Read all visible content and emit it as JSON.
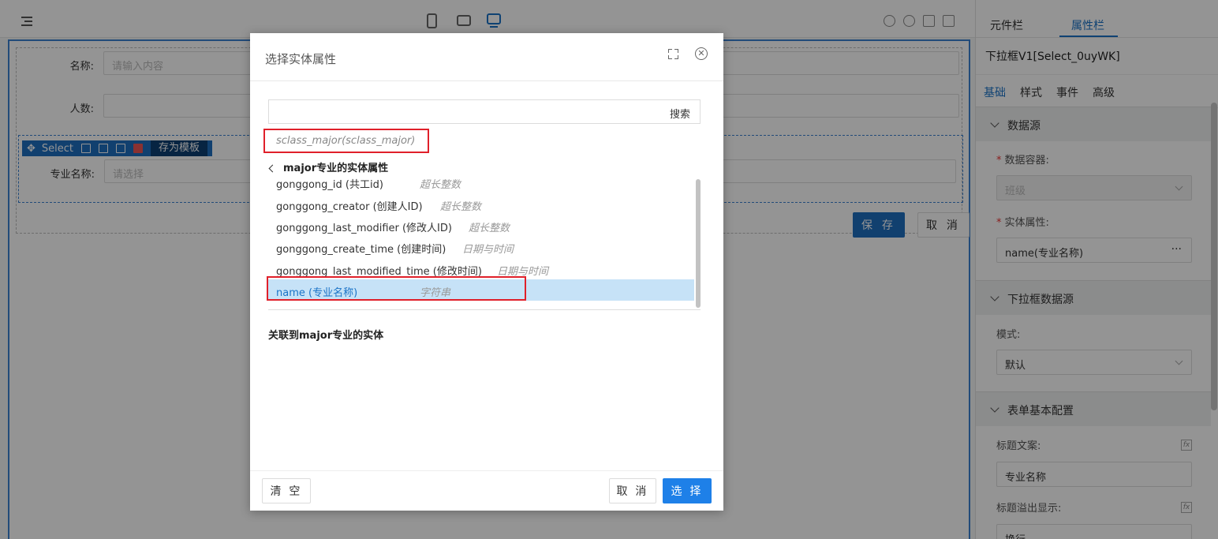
{
  "designer": {
    "form": {
      "name_label": "名称:",
      "name_placeholder": "请输入内容",
      "count_label": "人数:",
      "major_label": "专业名称:",
      "major_placeholder": "请选择"
    },
    "select_toolbar": {
      "label": "Select",
      "template_label": "存为模板"
    },
    "save_label": "保 存",
    "cancel_label": "取 消"
  },
  "right_panel": {
    "tabs": [
      "元件栏",
      "属性栏"
    ],
    "active_tab": "属性栏",
    "component_title": "下拉框V1[Select_0uyWK]",
    "subtabs": [
      "基础",
      "样式",
      "事件",
      "高级"
    ],
    "sections": {
      "datasource": {
        "title": "数据源",
        "container_label": "数据容器:",
        "container_value": "班级",
        "entity_attr_label": "实体属性:",
        "entity_attr_value": "name(专业名称)",
        "entity_attr_more": "···"
      },
      "select_datasource": {
        "title": "下拉框数据源",
        "mode_label": "模式:",
        "mode_value": "默认"
      },
      "form_config": {
        "title": "表单基本配置",
        "title_text_label": "标题文案:",
        "title_text_value": "专业名称",
        "overflow_label": "标题溢出显示:",
        "overflow_value": "换行",
        "fx_label": "fx"
      }
    }
  },
  "dialog": {
    "title": "选择实体属性",
    "search_button": "搜索",
    "breadcrumb": "sclass_major(sclass_major)",
    "back_label": "major专业的实体属性",
    "attributes": [
      {
        "name": "gonggong_id (共工id)",
        "type": "超长整数"
      },
      {
        "name": "gonggong_creator (创建人ID)",
        "type": "超长整数"
      },
      {
        "name": "gonggong_last_modifier (修改人ID)",
        "type": "超长整数"
      },
      {
        "name": "gonggong_create_time (创建时间)",
        "type": "日期与时间"
      },
      {
        "name": "gonggong_last_modified_time (修改时间)",
        "type": "日期与时间"
      },
      {
        "name": "name (专业名称)",
        "type": "字符串"
      }
    ],
    "selected_index": 5,
    "related_label": "关联到major专业的实体",
    "clear_label": "清 空",
    "cancel_label": "取 消",
    "choose_label": "选 择"
  },
  "colors": {
    "accent": "#1e80e8",
    "highlight": "#c6e2f7",
    "annotation_red": "#e0202a"
  }
}
